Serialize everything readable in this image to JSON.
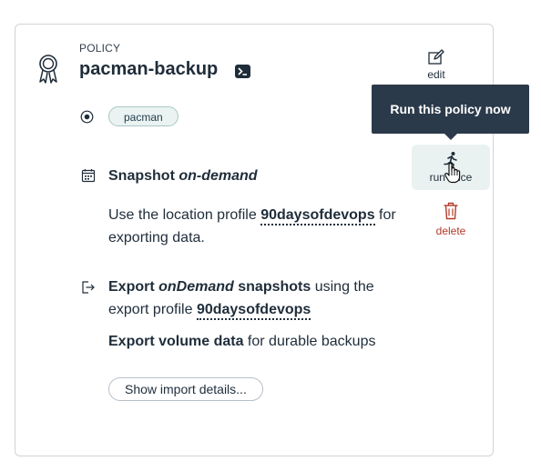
{
  "card": {
    "kicker": "POLICY",
    "title": "pacman-backup",
    "chip": "pacman"
  },
  "snapshot": {
    "lead": "Snapshot ",
    "mode": "on-demand",
    "desc_prefix": "Use the location profile ",
    "profile": "90daysofdevops",
    "desc_suffix_1": " for",
    "desc_suffix_2": "exporting data."
  },
  "export": {
    "lead": "Export ",
    "mode": "onDemand",
    "lead2": " snapshots",
    "using": " using the",
    "profile_prefix": "export profile ",
    "profile": "90daysofdevops",
    "volume_bold": "Export volume data",
    "volume_rest": " for durable backups"
  },
  "import_button": "Show import details...",
  "actions": {
    "edit": "edit",
    "run_once": "run once",
    "delete": "delete"
  },
  "tooltip": "Run this policy now",
  "colors": {
    "danger": "#b33a28",
    "accent_bg": "#e9f2f1",
    "tooltip_bg": "#2b3a4a"
  }
}
